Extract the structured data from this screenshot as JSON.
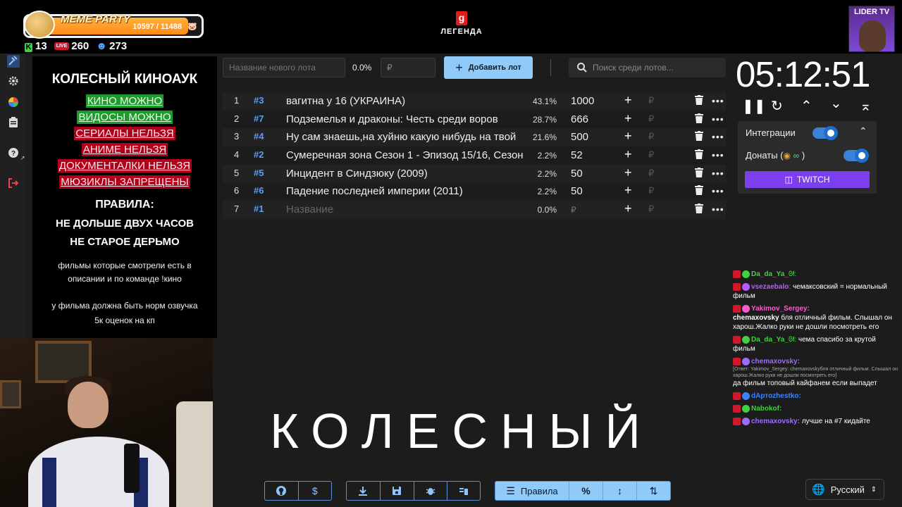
{
  "header": {
    "meme_party": {
      "title": "MEME PARTY",
      "progress_text": "10597 / 11488",
      "progress": 0.922
    },
    "stats": {
      "kick": "13",
      "live": "260",
      "viewers": "273"
    },
    "logo_text": "ЛЕГЕНДА",
    "logo_letter": "g",
    "channel_badge": "LIDER TV"
  },
  "rules": {
    "title": "КОЛЕСНЫЙ КИНОАУК",
    "tags": [
      {
        "text": "КИНО МОЖНО",
        "status": "allowed"
      },
      {
        "text": "ВИДОСЫ МОЖНО",
        "status": "allowed"
      },
      {
        "text": "СЕРИАЛЫ НЕЛЬЗЯ",
        "status": "banned"
      },
      {
        "text": "АНИМЕ НЕЛЬЗЯ",
        "status": "banned"
      },
      {
        "text": "ДОКУМЕНТАЛКИ НЕЛЬЗЯ",
        "status": "banned"
      },
      {
        "text": "МЮЗИКЛЫ ЗАПРЕЩЕНЫ",
        "status": "banned"
      }
    ],
    "rules_heading": "ПРАВИЛА:",
    "rule1": "НЕ ДОЛЬШЕ ДВУХ ЧАСОВ",
    "rule2": "НЕ СТАРОЕ ДЕРЬМО",
    "note1": "фильмы которые смотрели есть в описании и по команде !кино",
    "note2": "у фильма должна быть норм озвучка",
    "note3": "5к оценок на кп"
  },
  "toolbar": {
    "new_lot_placeholder": "Название нового лота",
    "new_lot_percent": "0.0%",
    "price_placeholder": "₽",
    "add_lot_label": "Добавить лот",
    "search_placeholder": "Поиск среди лотов..."
  },
  "lots": [
    {
      "index": "1",
      "id": "#3",
      "name": "вагитна у 16 (УКРАИНА)",
      "percent": "43.1%",
      "amount": "1000"
    },
    {
      "index": "2",
      "id": "#7",
      "name": "Подземелья и драконы: Честь среди воров",
      "percent": "28.7%",
      "amount": "666"
    },
    {
      "index": "3",
      "id": "#4",
      "name": "Ну сам знаешь,на хуйню какую нибудь на твой",
      "percent": "21.6%",
      "amount": "500"
    },
    {
      "index": "4",
      "id": "#2",
      "name": "Сумеречная зона Сезон 1 - Эпизод 15/16, Сезон",
      "percent": "2.2%",
      "amount": "52"
    },
    {
      "index": "5",
      "id": "#5",
      "name": "Инцидент в Синдзюку (2009)",
      "percent": "2.2%",
      "amount": "50"
    },
    {
      "index": "6",
      "id": "#6",
      "name": "Падение последней империи (2011)",
      "percent": "2.2%",
      "amount": "50"
    },
    {
      "index": "7",
      "id": "#1",
      "name": "Название",
      "percent": "0.0%",
      "amount": "₽",
      "placeholder": true
    }
  ],
  "lot_rub_symbol": "₽",
  "big_title": "КОЛЕСНЫЙ",
  "bottom_bar": {
    "rules_label": "Правила",
    "percent_symbol": "%"
  },
  "timer": {
    "time": "05:12:51"
  },
  "integrations": {
    "title": "Интеграции",
    "donations_label": "Донаты (",
    "donations_suffix": ")",
    "twitch_label": "TWITCH",
    "integrations_on": true,
    "donations_on": true
  },
  "chat": [
    {
      "nick": "Da_da_Ya_",
      "nick_color": "#3fd13f",
      "suffix": "ᘛ:",
      "text": ""
    },
    {
      "nick": "vsezaebalo",
      "nick_color": "#b65cff",
      "suffix": ":",
      "text": "чемаксовский = нормальный фильм"
    },
    {
      "nick": "Yakimov_Sergey:",
      "nick_color": "#ff5ad1",
      "suffix": "",
      "text_bold": "chemaxovsky",
      "text": "бля отличный фильм. Слышал он харош.Жалко руки не дошли посмотреть его"
    },
    {
      "nick": "Da_da_Ya_",
      "nick_color": "#3fd13f",
      "suffix": "ᘛ:",
      "text": "чема спасибо за крутой фильм"
    },
    {
      "nick": "chemaxovsky:",
      "nick_color": "#9c6bff",
      "suffix": "",
      "reply": "[Ответ: Yakimov_Sergey: chemaxovskyбля отличный фильм. Слышал он харош.Жалко руки не дошли посмотреть его]",
      "text": "да фильм топовый кайфанем если выпадет"
    },
    {
      "nick": "dАртоzhestko:",
      "nick_color": "#3b82ff",
      "suffix": "",
      "text": ""
    },
    {
      "nick": "Nabokof:",
      "nick_color": "#3fd13f",
      "suffix": "",
      "text": ""
    },
    {
      "nick": "chemaxovsky:",
      "nick_color": "#9c6bff",
      "suffix": "",
      "text": "лучше на #7 кидайте"
    }
  ],
  "language": "Русский",
  "colors": {
    "accent": "#90caf9",
    "twitch": "#7b3ff0",
    "allowed": "#1f9a2d",
    "banned": "#b3001a",
    "id": "#5d9df5"
  }
}
